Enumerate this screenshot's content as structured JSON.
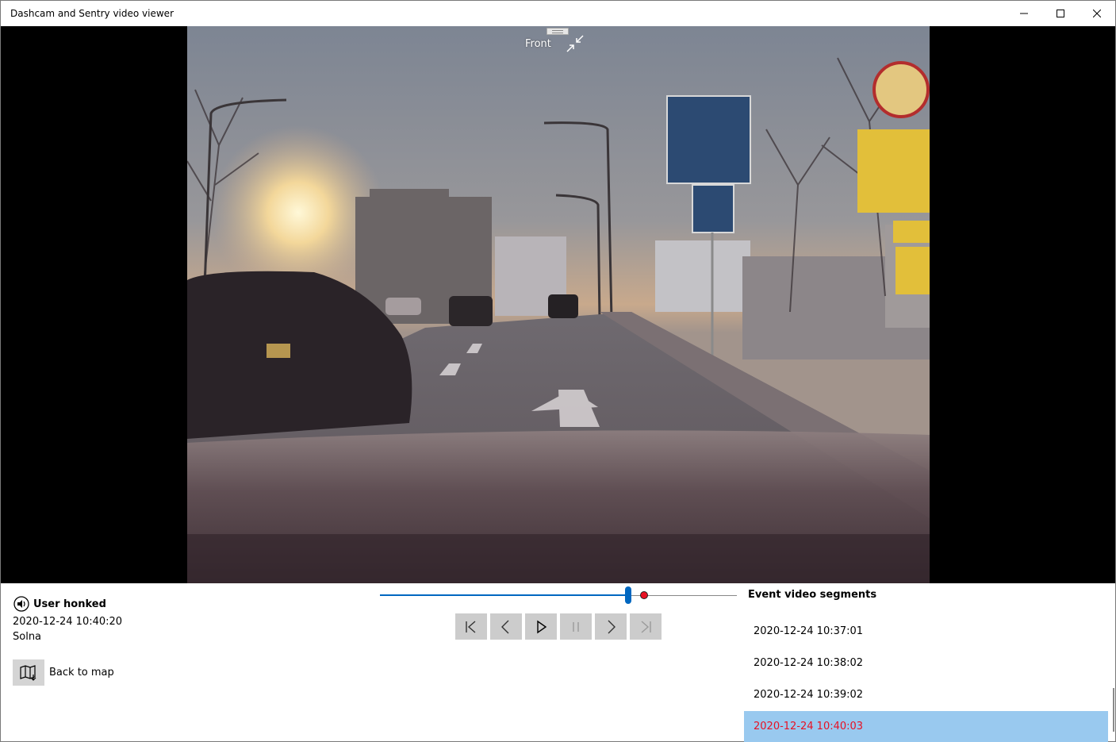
{
  "window": {
    "title": "Dashcam and Sentry video viewer"
  },
  "video": {
    "camera_label": "Front"
  },
  "event": {
    "icon": "speaker-icon",
    "title": "User honked",
    "timestamp": "2020-12-24 10:40:20",
    "location": "Solna"
  },
  "back": {
    "icon": "map-icon",
    "label": "Back to map"
  },
  "playback": {
    "position": 0.695,
    "event_marker": 0.74
  },
  "controls": [
    "skip-to-start",
    "previous",
    "play",
    "pause",
    "next",
    "skip-to-end"
  ],
  "segments": {
    "heading": "Event video segments",
    "items": [
      {
        "label": "2020-12-24 10:37:01",
        "selected": false
      },
      {
        "label": "2020-12-24 10:38:02",
        "selected": false
      },
      {
        "label": "2020-12-24 10:39:02",
        "selected": false
      },
      {
        "label": "2020-12-24 10:40:03",
        "selected": true
      }
    ]
  },
  "colors": {
    "accent": "#0067c0",
    "selected_bg": "#99c9ef",
    "event_red": "#e81123"
  }
}
